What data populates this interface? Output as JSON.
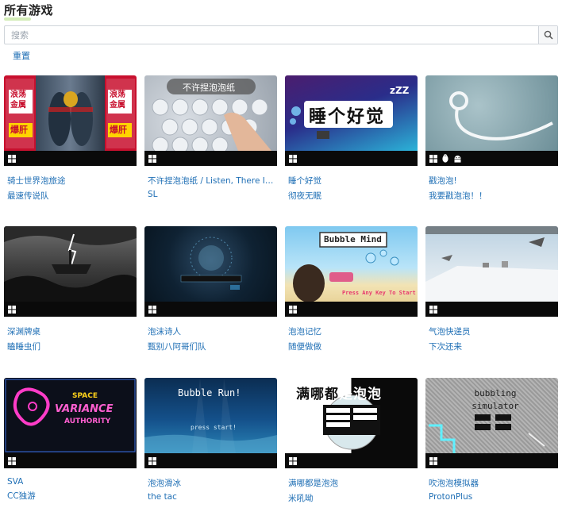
{
  "page": {
    "title": "所有游戏"
  },
  "search": {
    "placeholder": "搜索",
    "value": ""
  },
  "reset_label": "重置",
  "games": [
    {
      "title": "骑士世界泡旅途",
      "author": "最速传说队",
      "platforms": [
        "windows-icon"
      ],
      "thumb_text": "浪荡金属 爆肝"
    },
    {
      "title": "不许捏泡泡纸 / Listen, There Is Bubble Wrap",
      "author": "SL",
      "platforms": [
        "windows-icon"
      ],
      "thumb_text": "不许捏泡泡纸"
    },
    {
      "title": "睡个好觉",
      "author": "彻夜无眠",
      "platforms": [
        "windows-icon"
      ],
      "thumb_text": "睡个好觉"
    },
    {
      "title": "戳泡泡!",
      "author": "我要戳泡泡！！",
      "platforms": [
        "windows-icon",
        "linux-icon",
        "android-icon"
      ],
      "thumb_text": ""
    },
    {
      "title": "深渊牌桌",
      "author": "瞌睡虫们",
      "platforms": [
        "windows-icon"
      ],
      "thumb_text": ""
    },
    {
      "title": "泡沫诗人",
      "author": "甄别八阿哥们队",
      "platforms": [
        "windows-icon"
      ],
      "thumb_text": ""
    },
    {
      "title": "泡泡记忆",
      "author": "随便做做",
      "platforms": [
        "windows-icon"
      ],
      "thumb_text": "Bubble Mind"
    },
    {
      "title": "气泡快递员",
      "author": "下次还来",
      "platforms": [
        "windows-icon"
      ],
      "thumb_text": ""
    },
    {
      "title": "SVA",
      "author": "CC独游",
      "platforms": [
        "windows-icon"
      ],
      "thumb_text": "SPACE VARIANCE AUTHORITY"
    },
    {
      "title": "泡泡滑冰",
      "author": "the tac",
      "platforms": [
        "windows-icon"
      ],
      "thumb_text": "Bubble Run!"
    },
    {
      "title": "满哪都是泡泡",
      "author": "米吼呦",
      "platforms": [
        "windows-icon"
      ],
      "thumb_text": "满哪都是泡泡"
    },
    {
      "title": "吹泡泡模拟器",
      "author": "ProtonPlus",
      "platforms": [
        "windows-icon"
      ],
      "thumb_text": "bubbling simulator"
    }
  ]
}
